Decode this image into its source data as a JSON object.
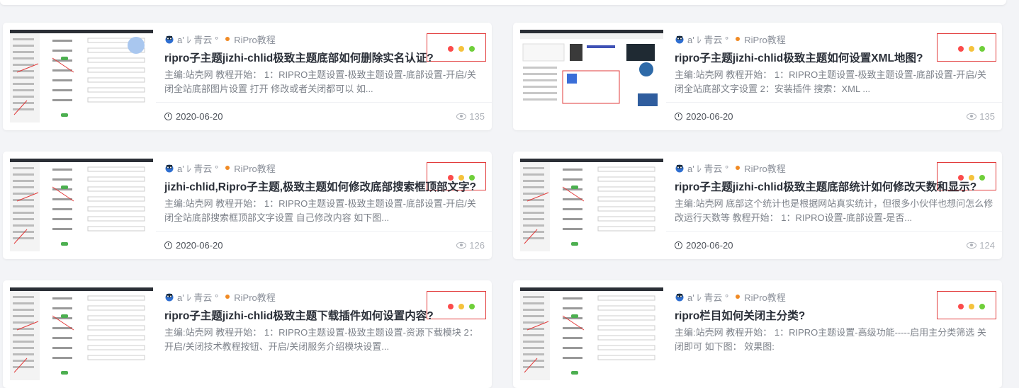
{
  "colors": {
    "accent_red": "#fb4b4b",
    "accent_yellow": "#f5c23c",
    "accent_green": "#6fcf3a",
    "category_dot": "#f08a24"
  },
  "cards": [
    {
      "author": "a' ﾚ 青云 °",
      "category": "RiPro教程",
      "title": "ripro子主题jizhi-chlid极致主题底部如何删除实名认证?",
      "excerpt": "主编:站壳网 教程开始： 1：RIPRO主题设置-极致主题设置-底部设置-开启/关闭全站底部图片设置  打开 修改或者关闭都可以 如...",
      "date": "2020-06-20",
      "views": "135"
    },
    {
      "author": "a' ﾚ 青云 °",
      "category": "RiPro教程",
      "title": "ripro子主题jizhi-chlid极致主题如何设置XML地图?",
      "excerpt": "主编:站壳网 教程开始： 1：RIPRO主题设置-极致主题设置-底部设置-开启/关闭全站底部文字设置 2：安装插件 搜索：XML  ...",
      "date": "2020-06-20",
      "views": "135"
    },
    {
      "author": "a' ﾚ 青云 °",
      "category": "RiPro教程",
      "title": "jizhi-chlid,Ripro子主题,极致主题如何修改底部搜索框顶部文字?",
      "excerpt": "主编:站壳网 教程开始： 1：RIPRO主题设置-极致主题设置-底部设置-开启/关闭全站底部搜索框顶部文字设置 自己修改内容 如下图...",
      "date": "2020-06-20",
      "views": "126"
    },
    {
      "author": "a' ﾚ 青云 °",
      "category": "RiPro教程",
      "title": "ripro子主题jizhi-chlid极致主题底部统计如何修改天数和显示?",
      "excerpt": "主编:站壳网 底部这个统计也是根据网站真实统计，但很多小伙伴也想问怎么修改运行天数等 教程开始： 1：RIPRO设置-底部设置-是否...",
      "date": "2020-06-20",
      "views": "124"
    },
    {
      "author": "a' ﾚ 青云 °",
      "category": "RiPro教程",
      "title": "ripro子主题jizhi-chlid极致主题下载插件如何设置内容?",
      "excerpt": "主编:站壳网 教程开始： 1：RIPRO主题设置-极致主题设置-资源下载模块 2：开启/关闭技术教程按钮、开启/关闭服务介绍模块设置...",
      "date": "",
      "views": ""
    },
    {
      "author": "a' ﾚ 青云 °",
      "category": "RiPro教程",
      "title": "ripro栏目如何关闭主分类?",
      "excerpt": "主编:站壳网 教程开始： 1：RIPRO主题设置-高级功能-----启用主分类筛选 关闭即可 如下图： 效果图:",
      "date": "",
      "views": ""
    }
  ]
}
